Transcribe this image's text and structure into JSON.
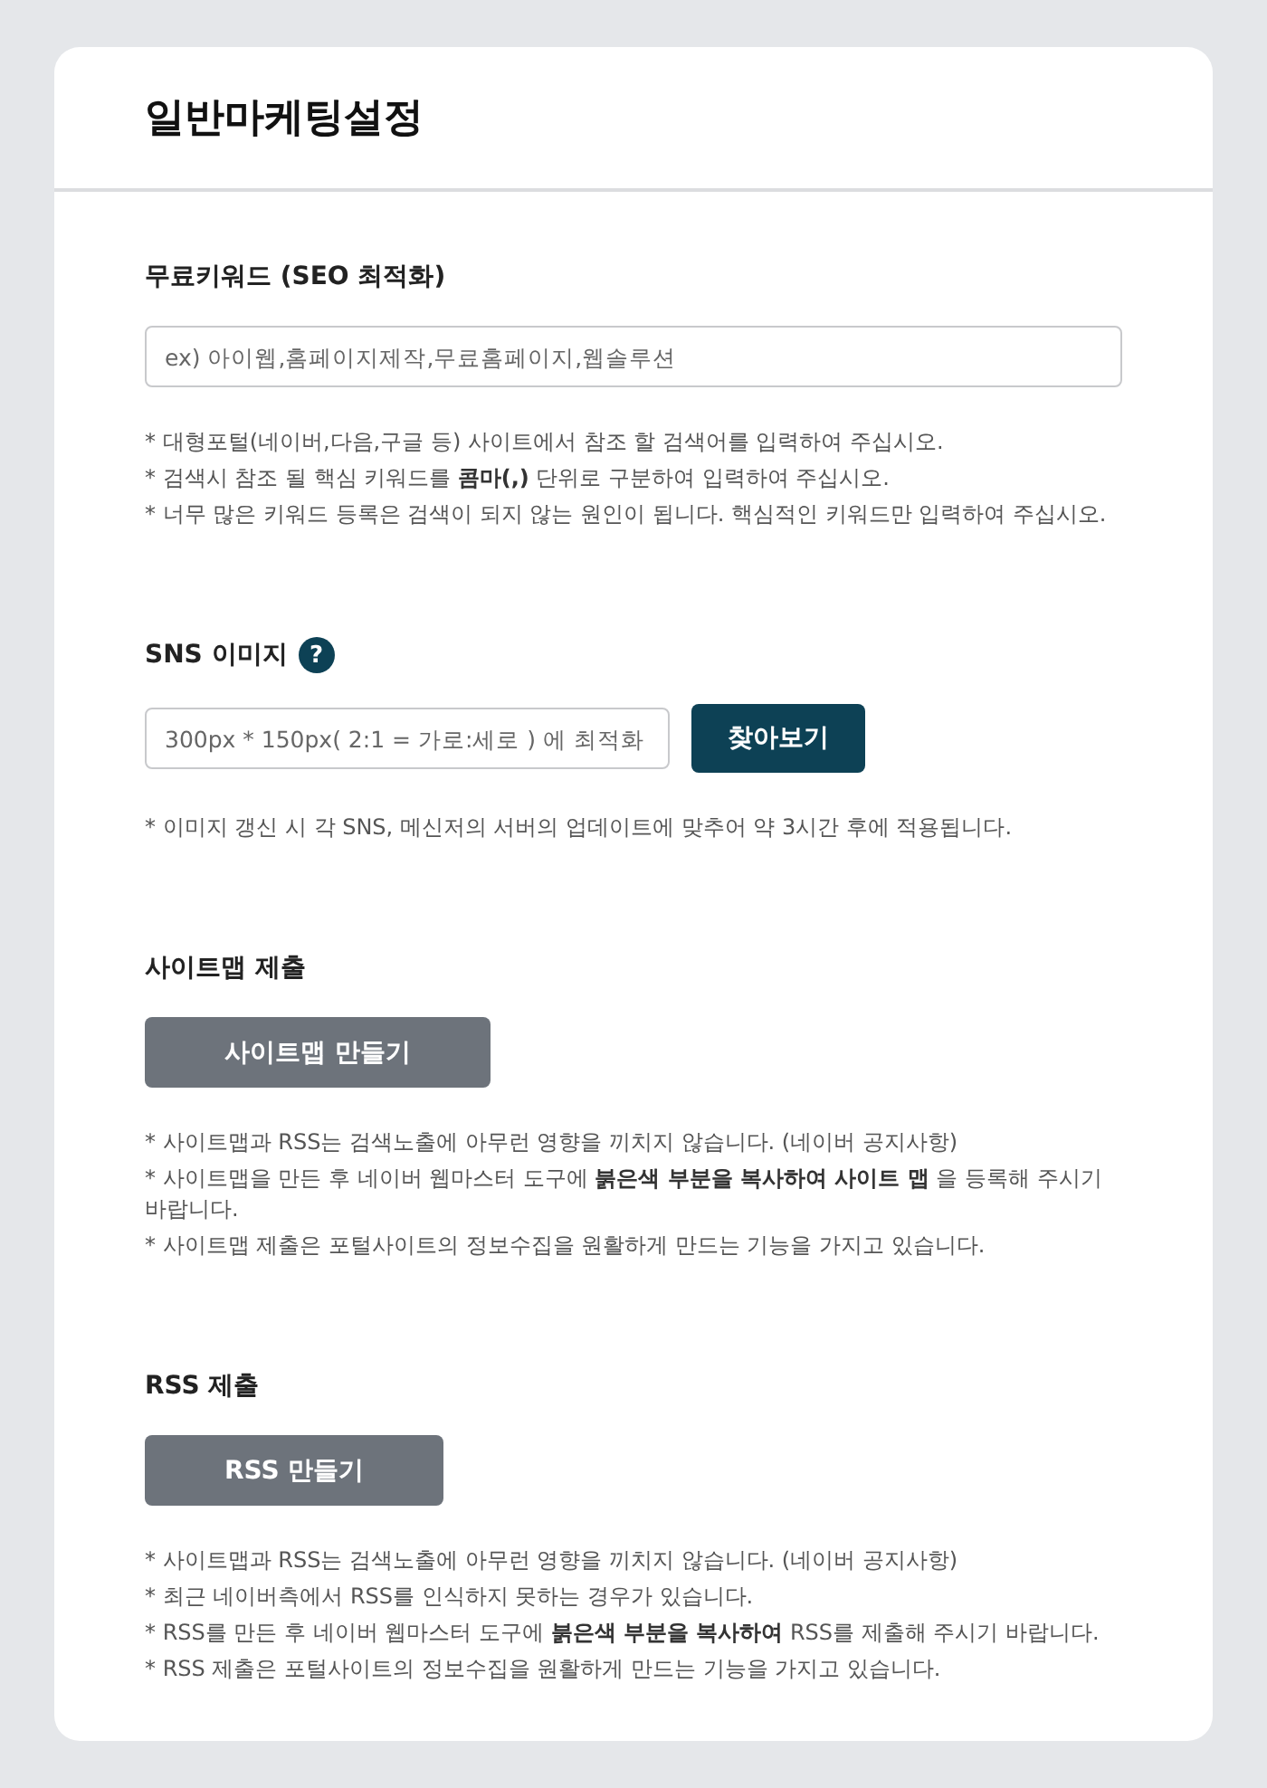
{
  "title": "일반마케팅설정",
  "sections": [
    {
      "kind": "text-input",
      "heading": "무료키워드 (SEO 최적화)",
      "field": {
        "placeholder": "ex) 아이웹,홈페이지제작,무료홈페이지,웹솔루션"
      },
      "notes": [
        "* 대형포털(네이버,다음,구글 등) 사이트에서 참조 할 검색어를 입력하여 주십시오.",
        "* 검색시 참조 될 핵심 키워드를 **콤마(,)** 단위로 구분하여 입력하여 주십시오.",
        "* 너무 많은 키워드 등록은 검색이 되지 않는 원인이 됩니다. 핵심적인 키워드만 입력하여 주십시오."
      ]
    },
    {
      "kind": "file-input",
      "heading": "SNS 이미지",
      "help": "?",
      "field": {
        "placeholder": "300px * 150px( 2:1 = 가로:세로 ) 에 최적화"
      },
      "button": "찾아보기",
      "notes": [
        "* 이미지 갱신 시 각 SNS, 메신저의 서버의 업데이트에 맞추어 약 3시간 후에 적용됩니다."
      ]
    },
    {
      "kind": "action",
      "heading": "사이트맵 제출",
      "button": "사이트맵 만들기",
      "notes": [
        "* 사이트맵과 RSS는 검색노출에 아무런 영향을 끼치지 않습니다. (네이버 공지사항)",
        "* 사이트맵을 만든 후 네이버 웹마스터 도구에 **붉은색 부분을 복사하여 사이트 맵** 을 등록해 주시기 바랍니다.",
        "* 사이트맵 제출은 포털사이트의 정보수집을 원활하게 만드는 기능을 가지고 있습니다."
      ]
    },
    {
      "kind": "action",
      "heading": "RSS 제출",
      "button": "RSS 만들기",
      "notes": [
        "* 사이트맵과 RSS는 검색노출에 아무런 영향을 끼치지 않습니다. (네이버 공지사항)",
        "* 최근 네이버측에서 RSS를 인식하지 못하는 경우가 있습니다.",
        "* RSS를 만든 후 네이버 웹마스터 도구에 **붉은색 부분을 복사하여** RSS를 제출해 주시기 바랍니다.",
        "* RSS 제출은 포털사이트의 정보수집을 원활하게 만드는 기능을 가지고 있습니다."
      ]
    }
  ]
}
